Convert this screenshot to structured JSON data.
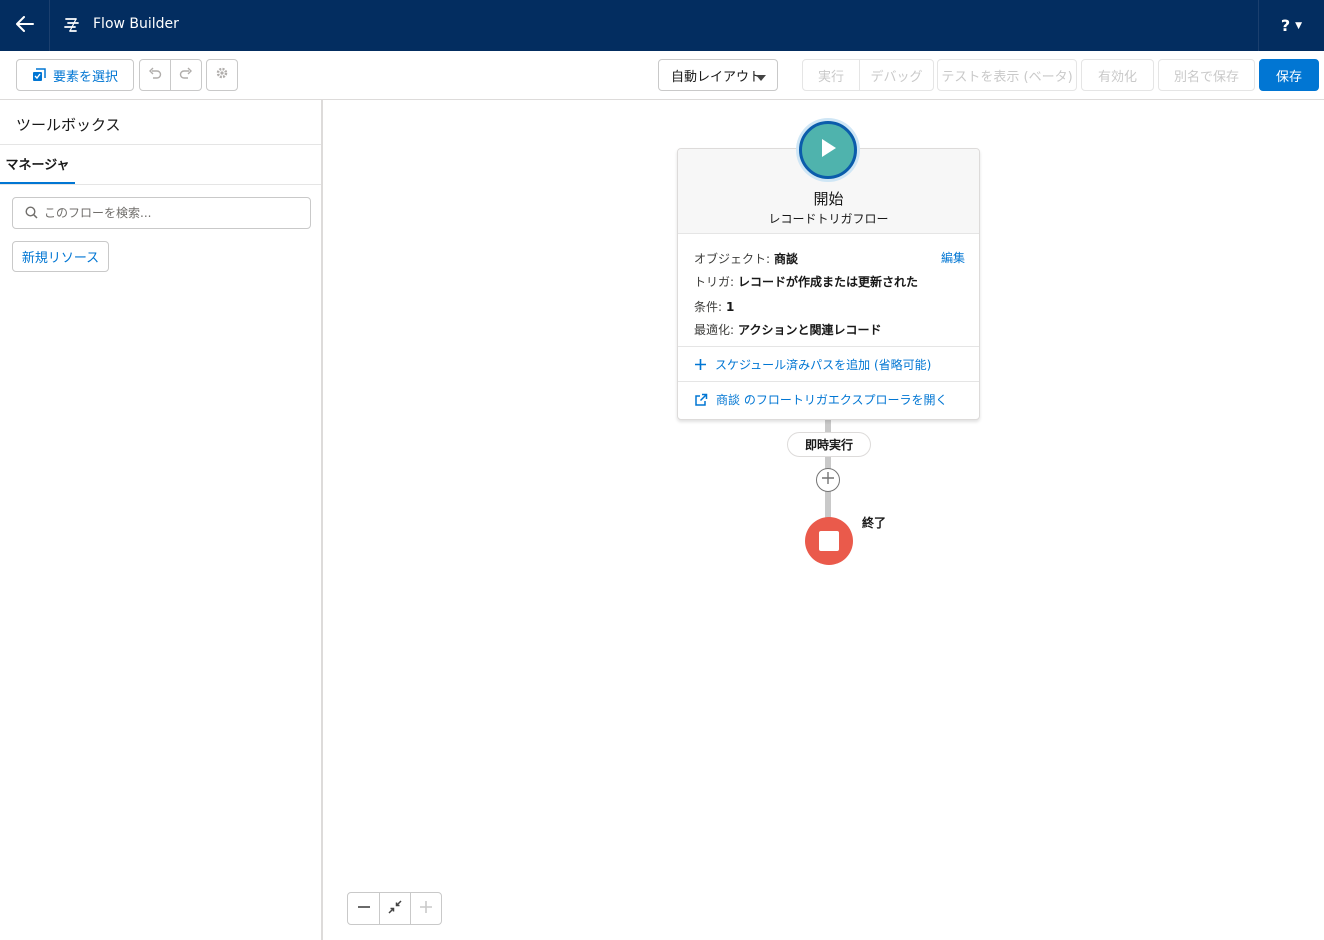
{
  "header": {
    "title": "Flow Builder",
    "help_label": "?",
    "back_icon": "arrow-left-icon",
    "logo_icon": "flow-icon"
  },
  "toolbar": {
    "select_elements_label": "要素を選択",
    "layout_select_value": "自動レイアウト",
    "run_label": "実行",
    "debug_label": "デバッグ",
    "test_label": "テストを表示 (ベータ)",
    "activate_label": "有効化",
    "save_as_label": "別名で保存",
    "save_label": "保存"
  },
  "toolbox": {
    "title": "ツールボックス",
    "tab_manager": "マネージャ",
    "search_placeholder": "このフローを検索...",
    "new_resource_label": "新規リソース"
  },
  "start_node": {
    "title": "開始",
    "subtitle": "レコードトリガフロー",
    "object_label": "オブジェクト:",
    "object_value": "商談",
    "trigger_label": "トリガ:",
    "trigger_value": "レコードが作成または更新された",
    "condition_label": "条件:",
    "condition_value": "1",
    "optimize_label": "最適化:",
    "optimize_value": "アクションと関連レコード",
    "edit_label": "編集",
    "add_scheduled_path_label": "スケジュール済みパスを追加 (省略可能)",
    "open_explorer_label": "商談 のフロートリガエクスプローラを開く"
  },
  "canvas": {
    "run_immediately_label": "即時実行",
    "end_label": "終了"
  },
  "colors": {
    "header_bg": "#032d60",
    "brand": "#0176d3",
    "start_node": "#4fb3ad",
    "end_node": "#ea5a4b"
  }
}
